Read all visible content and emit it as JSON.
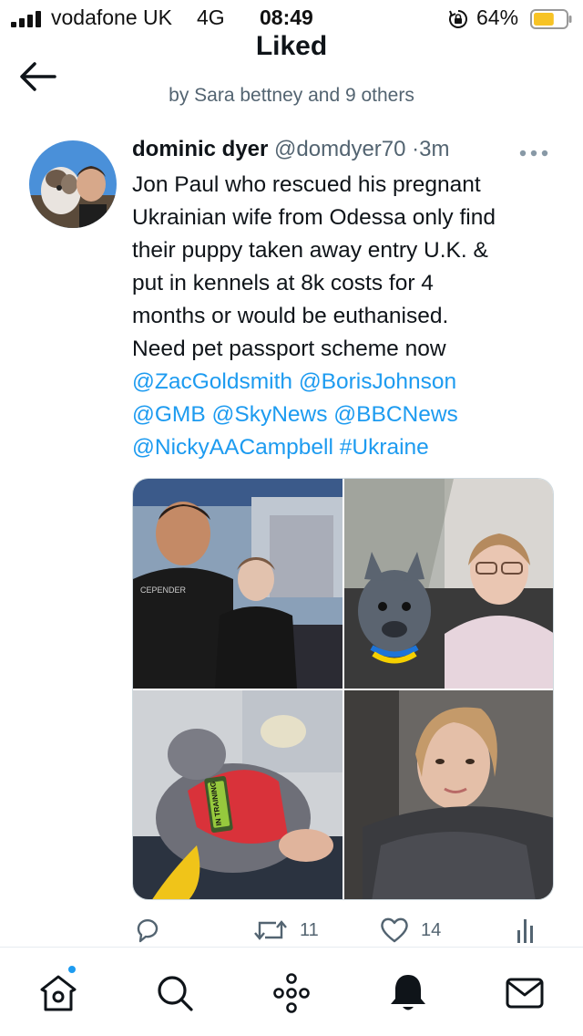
{
  "status_bar": {
    "carrier": "vodafone UK",
    "network": "4G",
    "time": "08:49",
    "battery_percent": "64%",
    "battery_level": 0.64,
    "battery_color": "#f7c325",
    "icons": [
      "cellular-signal-icon",
      "rotation-lock-icon",
      "battery-icon"
    ]
  },
  "header": {
    "title": "Liked",
    "subtitle": "by Sara bettney and 9 others",
    "back_icon": "back-arrow-icon"
  },
  "tweet": {
    "author_name": "dominic dyer",
    "author_handle": "@domdyer70",
    "separator": "·",
    "time": "3m",
    "more_icon": "more-dots-icon",
    "text_lines": [
      "Jon Paul who rescued his pregnant",
      "Ukrainian wife from Odessa only find",
      "their puppy  taken away entry U.K. &",
      "put in kennels at 8k costs for 4",
      "months or would be euthanised.",
      "Need pet passport scheme now"
    ],
    "mentions": {
      "line1": [
        "@ZacGoldsmith",
        "@BorisJohnson"
      ],
      "line2": [
        "@GMB",
        "@SkyNews",
        "@BBCNews"
      ],
      "line3_mention": "@NickyAACampbell",
      "line3_hashtag": "#Ukraine"
    },
    "link_color": "#1d9bf0",
    "media": [
      {
        "name": "photo-couple-on-train"
      },
      {
        "name": "photo-woman-with-puppy-in-car"
      },
      {
        "name": "photo-puppy-in-harness"
      },
      {
        "name": "photo-woman-selfie"
      }
    ],
    "harness_text": "IN TRAINING",
    "shirt_text": "CEPENDER",
    "actions": {
      "reply_count": "",
      "retweet_count": "11",
      "like_count": "14",
      "icons": [
        "reply-icon",
        "retweet-icon",
        "like-heart-icon",
        "analytics-icon"
      ]
    }
  },
  "bottom_nav": {
    "items": [
      "home-icon",
      "search-icon",
      "spaces-icon",
      "notifications-bell-icon",
      "messages-envelope-icon"
    ],
    "accent": "#1d9bf0"
  }
}
